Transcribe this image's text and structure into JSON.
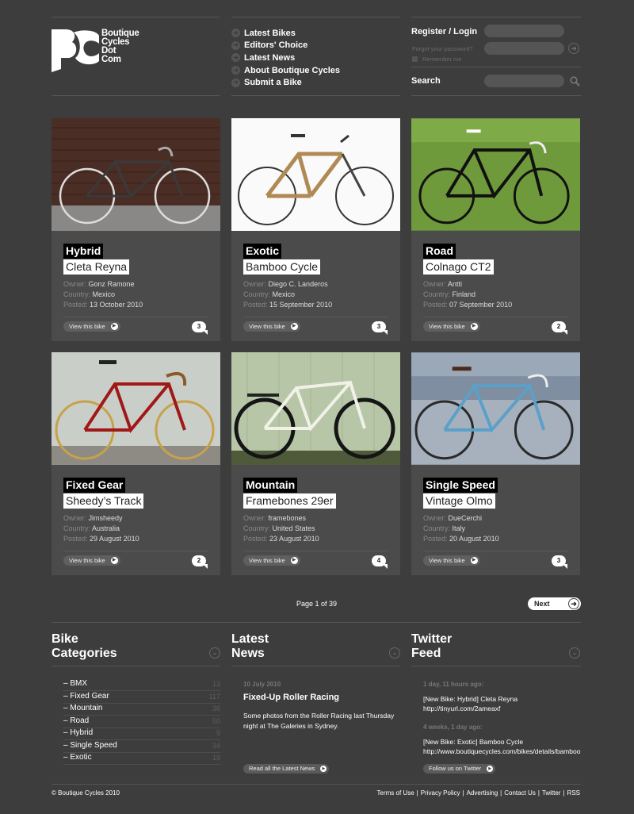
{
  "logo": {
    "line1": "Boutique",
    "line2": "Cycles",
    "line3": "Dot",
    "line4": "Com"
  },
  "nav": [
    {
      "label": "Latest Bikes"
    },
    {
      "label": "Editors' Choice"
    },
    {
      "label": "Latest News"
    },
    {
      "label": "About Boutique Cycles"
    },
    {
      "label": "Submit a Bike"
    }
  ],
  "login": {
    "title": "Register / Login",
    "forgot": "Forgot your password?",
    "remember": "Remember me",
    "search_label": "Search"
  },
  "bikes": [
    {
      "category": "Hybrid",
      "name": "Cleta Reyna",
      "owner": "Gonz Ramone",
      "country": "Mexico",
      "posted": "13 October 2010",
      "comments": "3"
    },
    {
      "category": "Exotic",
      "name": "Bamboo Cycle",
      "owner": "Diego C. Landeros",
      "country": "Mexico",
      "posted": "15 September 2010",
      "comments": "3"
    },
    {
      "category": "Road",
      "name": "Colnago CT2",
      "owner": "Antti",
      "country": "Finland",
      "posted": "07 September 2010",
      "comments": "2"
    },
    {
      "category": "Fixed Gear",
      "name": "Sheedy’s Track",
      "owner": "Jimsheedy",
      "country": "Australia",
      "posted": "29 August 2010",
      "comments": "2"
    },
    {
      "category": "Mountain",
      "name": "Framebones 29er",
      "owner": "framebones",
      "country": "United States",
      "posted": "23 August 2010",
      "comments": "4"
    },
    {
      "category": "Single Speed",
      "name": "Vintage Olmo",
      "owner": "DueCerchi",
      "country": "Italy",
      "posted": "20 August 2010",
      "comments": "3"
    }
  ],
  "card_labels": {
    "owner": "Owner:",
    "country": "Country:",
    "posted": "Posted:",
    "view": "View this bike"
  },
  "pagination": {
    "info": "Page 1 of 39",
    "next": "Next"
  },
  "categories": {
    "title1": "Bike",
    "title2": "Categories",
    "items": [
      {
        "label": "– BMX",
        "count": "13"
      },
      {
        "label": "– Fixed Gear",
        "count": "117"
      },
      {
        "label": "– Mountain",
        "count": "36"
      },
      {
        "label": "– Road",
        "count": "50"
      },
      {
        "label": "– Hybrid",
        "count": "9"
      },
      {
        "label": "– Single Speed",
        "count": "34"
      },
      {
        "label": "– Exotic",
        "count": "19"
      }
    ]
  },
  "news": {
    "title1": "Latest",
    "title2": "News",
    "date": "10 July 2010",
    "headline": "Fixed-Up Roller Racing",
    "body1": "Some photos from the Roller Racing last Thursday",
    "body2": "night at The Galeries in Sydney.",
    "button": "Read all the Latest News"
  },
  "twitter": {
    "title1": "Twitter",
    "title2": "Feed",
    "t1_time": "1 day, 11 hours ago:",
    "t1_text": "[New Bike: Hybrid] Cleta Reyna",
    "t1_link": "http://tinyurl.com/2ameaxf",
    "t2_time": "4 weeks, 1 day ago:",
    "t2_text": "[New Bike: Exotic] Bamboo Cycle",
    "t2_link": "http://www.boutiquecycles.com/bikes/details/bamboo",
    "button": "Follow us on Twitter"
  },
  "footer": {
    "copyright": "© Boutique Cycles 2010",
    "links": [
      "Terms of Use",
      "Privacy Policy",
      "Advertising",
      "Contact Us",
      "Twitter",
      "RSS"
    ]
  },
  "colors": {
    "background": "#3d3d3d",
    "card": "#4b4b4b",
    "accent_white": "#ffffff"
  }
}
